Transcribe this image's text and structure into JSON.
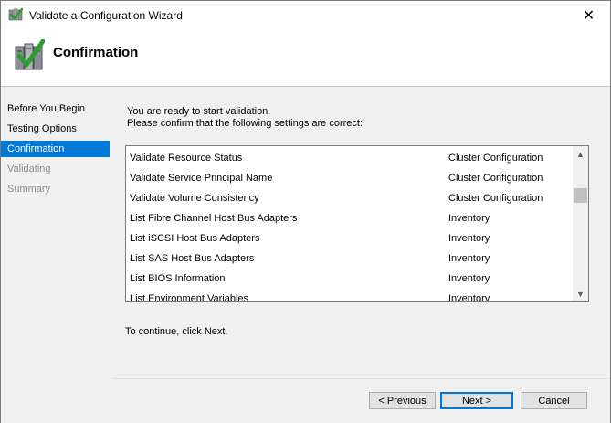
{
  "window": {
    "title": "Validate a Configuration Wizard",
    "close_glyph": "✕"
  },
  "header": {
    "title": "Confirmation"
  },
  "nav": {
    "items": [
      {
        "label": "Before You Begin",
        "state": "normal"
      },
      {
        "label": "Testing Options",
        "state": "normal"
      },
      {
        "label": "Confirmation",
        "state": "selected"
      },
      {
        "label": "Validating",
        "state": "disabled"
      },
      {
        "label": "Summary",
        "state": "disabled"
      }
    ]
  },
  "main": {
    "intro_line1": "You are ready to start validation.",
    "intro_line2": "Please confirm that the following settings are correct:",
    "rows": [
      {
        "test": "Validate Resource Status",
        "category": "Cluster Configuration"
      },
      {
        "test": "Validate Service Principal Name",
        "category": "Cluster Configuration"
      },
      {
        "test": "Validate Volume Consistency",
        "category": "Cluster Configuration"
      },
      {
        "test": "List Fibre Channel Host Bus Adapters",
        "category": "Inventory"
      },
      {
        "test": "List iSCSI Host Bus Adapters",
        "category": "Inventory"
      },
      {
        "test": "List SAS Host Bus Adapters",
        "category": "Inventory"
      },
      {
        "test": "List BIOS Information",
        "category": "Inventory"
      },
      {
        "test": "List Environment Variables",
        "category": "Inventory"
      }
    ],
    "continue_text": "To continue, click Next."
  },
  "buttons": {
    "previous": "< Previous",
    "next": "Next >",
    "cancel": "Cancel"
  },
  "colors": {
    "accent": "#0078d7",
    "panel": "#f0f0f0"
  },
  "icons": {
    "title": "cluster-check-icon",
    "header": "cluster-check-icon",
    "scroll_up": "▲",
    "scroll_down": "▼"
  }
}
